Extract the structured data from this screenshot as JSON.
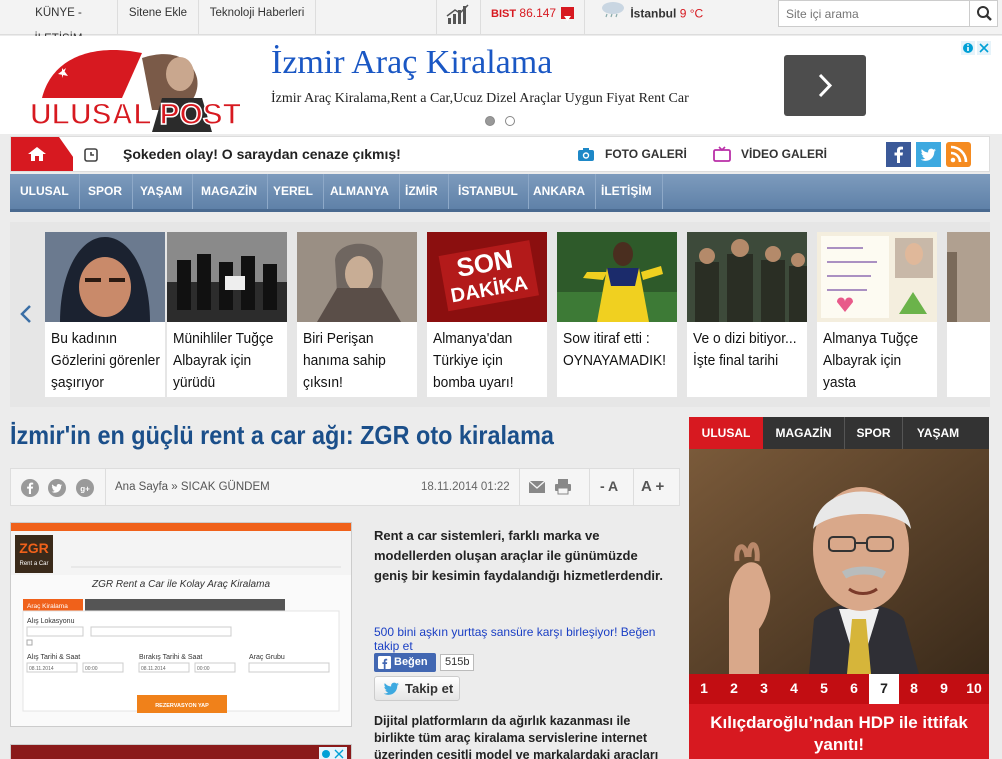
{
  "topbar": {
    "links": [
      "KÜNYE - İLETİŞİM",
      "Sitene Ekle",
      "Teknoloji Haberleri"
    ],
    "bist_label": "BIST",
    "bist_value": "86.147",
    "city": "İstanbul",
    "temperature": "9 °C",
    "search_placeholder": "Site içi arama"
  },
  "header": {
    "logo_text": "ULUSAL POST",
    "ad_title": "İzmir Araç Kiralama",
    "ad_description": "İzmir Araç Kiralama,Rent a Car,Ucuz Dizel Araçlar Uygun Fiyat Rent Car"
  },
  "breaking": {
    "text": "Şokeden olay! O saraydan cenaze çıkmış!",
    "photo_gallery": "FOTO GALERİ",
    "video_gallery": "VİDEO GALERİ"
  },
  "nav": {
    "items": [
      "ULUSAL",
      "SPOR",
      "YAŞAM",
      "MAGAZİN",
      "YEREL",
      "ALMANYA",
      "İZMİR",
      "İSTANBUL",
      "ANKARA",
      "İLETİŞİM"
    ]
  },
  "slider": {
    "cards": [
      {
        "caption": "Bu kadının Gözlerini görenler şaşırıyor"
      },
      {
        "caption": "Münihliler Tuğçe Albayrak için yürüdü"
      },
      {
        "caption": "Biri Perişan hanıma sahip çıksın!"
      },
      {
        "caption": "Almanya'dan Türkiye için bomba uyarı!"
      },
      {
        "caption": "Sow itiraf etti : OYNAYAMADIK!"
      },
      {
        "caption": "Ve o dizi bitiyor... İşte final tarihi"
      },
      {
        "caption": "Almanya Tuğçe Albayrak için yasta"
      }
    ],
    "son_dakika_line1": "SON",
    "son_dakika_line2": "DAKİKA"
  },
  "article": {
    "title": "İzmir'in en güçlü rent a car ağı: ZGR oto kiralama",
    "breadcrumb_home": "Ana Sayfa",
    "breadcrumb_section": "» SICAK GÜNDEM",
    "date": "18.11.2014 01:22",
    "font_minus": "- A",
    "font_plus": "A +",
    "lead": "Rent a car sistemleri, farklı marka ve modellerden oluşan araçlar ile günümüzde geniş bir kesimin faydalandığı hizmetlerdendir.",
    "follow_text": "500 bini aşkın yurttaş sansüre karşı birleşiyor! Beğen takip et",
    "fb_like": "Beğen",
    "fb_count": "515b",
    "twitter_follow": "Takip et",
    "body": "Dijital platformların da ağırlık kazanması ile birlikte tüm araç kiralama servislerine internet üzerinden çeşitli model ve markalardaki araçları"
  },
  "article_image": {
    "brand_top": "ZGR",
    "brand_bottom": "Rent a Car",
    "heading": "ZGR Rent a Car ile Kolay Araç Kiralama",
    "tab_active": "Araç Kiralama",
    "label_pickup": "Alış Lokasyonu",
    "label_pickup_date": "Alış Tarihi & Saat",
    "label_return_date": "Bırakış Tarihi & Saat",
    "label_group": "Araç Grubu",
    "date_value": "08.11.2014",
    "time_value": "00:00",
    "button": "REZERVASYON YAP"
  },
  "right_widget": {
    "tabs": [
      "ULUSAL",
      "MAGAZİN",
      "SPOR",
      "YAŞAM"
    ],
    "numbers": [
      "1",
      "2",
      "3",
      "4",
      "5",
      "6",
      "7",
      "8",
      "9",
      "10"
    ],
    "active_number": "7",
    "caption": "Kılıçdaroğlu’ndan HDP ile ittifak yanıtı!"
  },
  "colors": {
    "brand_red": "#d71920",
    "nav_blue": "#6a8bb2",
    "title_blue": "#1b4f8a",
    "ad_link_blue": "#1a57c4"
  }
}
